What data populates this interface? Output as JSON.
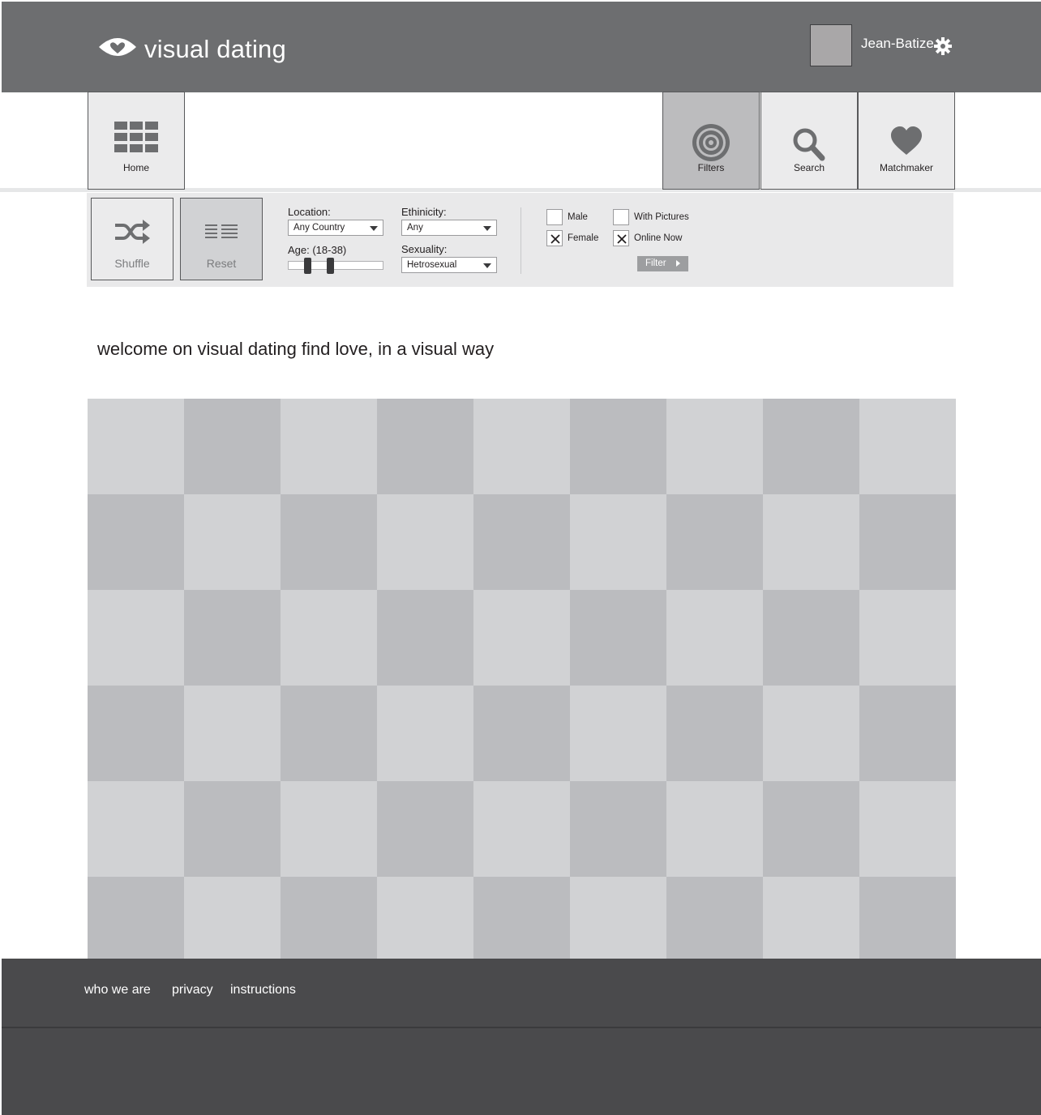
{
  "header": {
    "brand": "visual dating",
    "username": "Jean-Batize"
  },
  "nav": {
    "home": "Home",
    "filters": "Filters",
    "search": "Search",
    "matchmaker": "Matchmaker",
    "active": "filters"
  },
  "filters": {
    "shuffle_label": "Shuffle",
    "reset_label": "Reset",
    "location_label": "Location:",
    "location_value": "Any Country",
    "age_label": "Age: (18-38)",
    "age_range": [
      18,
      38
    ],
    "ethnicity_label": "Ethinicity:",
    "ethnicity_value": "Any",
    "sexuality_label": "Sexuality:",
    "sexuality_value": "Hetrosexual",
    "male_label": "Male",
    "male_checked": false,
    "female_label": "Female",
    "female_checked": true,
    "with_pictures_label": "With Pictures",
    "with_pictures_checked": false,
    "online_now_label": "Online Now",
    "online_now_checked": true,
    "filter_button": "Filter"
  },
  "welcome_text": "welcome on visual dating find love, in a visual way",
  "footer": {
    "links": [
      "who we are",
      "privacy",
      "instructions"
    ]
  },
  "colors": {
    "header_bg": "#6d6e70",
    "footer_bg": "#4a4a4c",
    "tile_light": "#d1d2d4",
    "tile_dark": "#bbbcbf",
    "active_nav_bg": "#bcbcbe"
  }
}
